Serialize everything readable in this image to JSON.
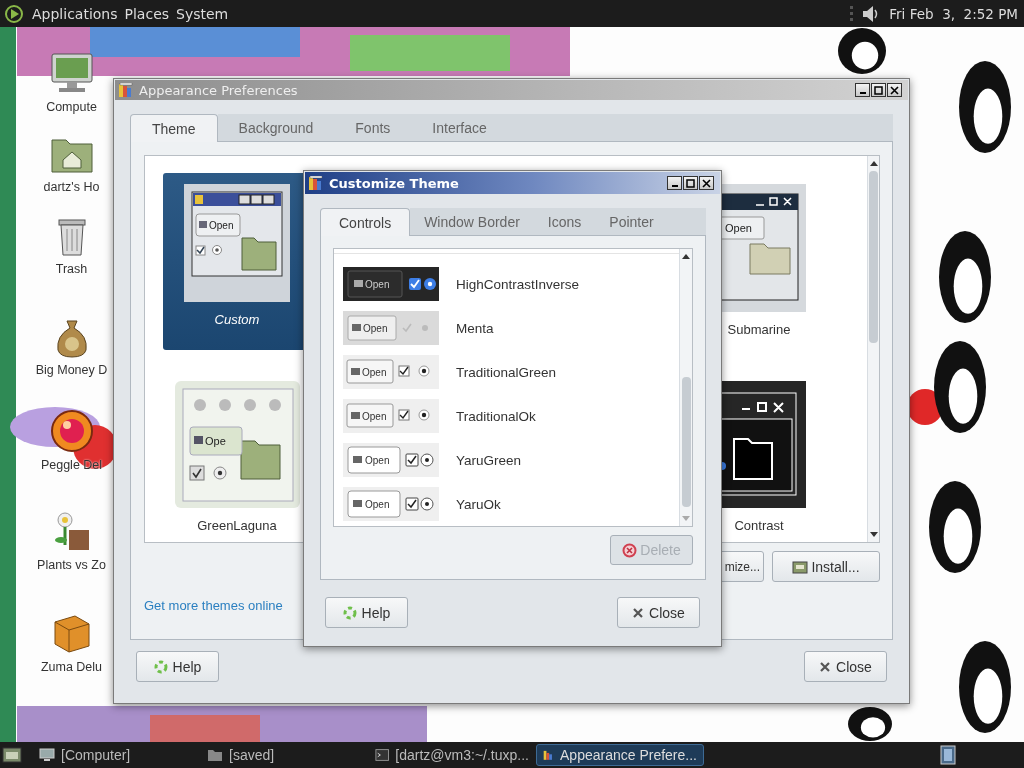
{
  "top_panel": {
    "menus": [
      "Applications",
      "Places",
      "System"
    ],
    "clock": "Fri Feb  3,  2:52 PM"
  },
  "desktop": {
    "icons": [
      {
        "label": "Compute",
        "kind": "computer"
      },
      {
        "label": "dartz's Ho",
        "kind": "home"
      },
      {
        "label": "Trash",
        "kind": "trash"
      },
      {
        "label": "Big Money D",
        "kind": "money"
      },
      {
        "label": "Peggle Del",
        "kind": "ball"
      },
      {
        "label": "Plants vs Zo",
        "kind": "plant"
      },
      {
        "label": "Zuma Delu",
        "kind": "block"
      }
    ]
  },
  "preferences_window": {
    "title": "Appearance Preferences",
    "tabs": [
      {
        "label": "Theme",
        "selected": true
      },
      {
        "label": "Background",
        "selected": false
      },
      {
        "label": "Fonts",
        "selected": false
      },
      {
        "label": "Interface",
        "selected": false
      }
    ],
    "themes": [
      {
        "name": "Custom",
        "kind": "classic",
        "button_text": "Open",
        "selected": true
      },
      {
        "name": "Submarine",
        "kind": "titlebar-dark",
        "button_text": "Open",
        "selected": false
      },
      {
        "name": "GreenLaguna",
        "kind": "glossy",
        "button_text": "Ope",
        "selected": false
      },
      {
        "name": "Contrast",
        "kind": "inverse",
        "selected": false
      }
    ],
    "buttons": [
      {
        "label": "mize...",
        "kind": "customize"
      },
      {
        "label": "Install...",
        "kind": "install"
      }
    ],
    "link": "Get more themes online",
    "footer_buttons": [
      {
        "label": "Help",
        "kind": "help"
      },
      {
        "label": "Close",
        "kind": "close"
      }
    ]
  },
  "customize_dialog": {
    "title": "Customize Theme",
    "tabs": [
      {
        "label": "Controls",
        "selected": true
      },
      {
        "label": "Window Border",
        "selected": false
      },
      {
        "label": "Icons",
        "selected": false
      },
      {
        "label": "Pointer",
        "selected": false
      }
    ],
    "themes": [
      {
        "name": "HighContrastInverse",
        "kind": "dark",
        "button_text": "Open",
        "selected": false
      },
      {
        "name": "Menta",
        "kind": "flat",
        "button_text": "Open",
        "selected": false
      },
      {
        "name": "TraditionalGreen",
        "kind": "classic",
        "button_text": "Open",
        "selected": false
      },
      {
        "name": "TraditionalOk",
        "kind": "classic",
        "button_text": "Open",
        "selected": false
      },
      {
        "name": "YaruGreen",
        "kind": "rounded",
        "button_text": "Open",
        "selected": false
      },
      {
        "name": "YaruOk",
        "kind": "rounded",
        "button_text": "Open",
        "selected": false
      }
    ],
    "delete_button": {
      "label": "Delete",
      "disabled": true
    },
    "footer_buttons": [
      {
        "label": "Help",
        "kind": "help"
      },
      {
        "label": "Close",
        "kind": "close"
      }
    ]
  },
  "taskbar": {
    "items": [
      {
        "label": "[Computer]",
        "kind": "computer",
        "selected": false
      },
      {
        "label": "[saved]",
        "kind": "folder",
        "selected": false
      },
      {
        "label": "[dartz@vm3:~/.tuxp...",
        "kind": "terminal",
        "selected": false
      },
      {
        "label": "Appearance Prefere...",
        "kind": "app",
        "selected": true
      }
    ]
  }
}
